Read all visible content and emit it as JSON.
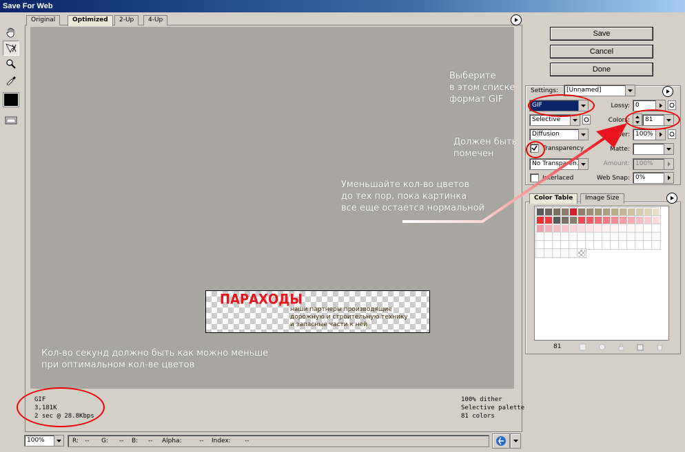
{
  "window": {
    "title": "Save For Web"
  },
  "tabs": [
    {
      "label": "Original"
    },
    {
      "label": "Optimized"
    },
    {
      "label": "2-Up"
    },
    {
      "label": "4-Up"
    }
  ],
  "preview": {
    "title": "ПАРАХОДЫ",
    "line1": "наши партнеры производящие",
    "line2": "дорожную и строительную технику",
    "line3": "и запасные части к ней"
  },
  "status_left": {
    "format": "GIF",
    "size": "3,181K",
    "time": "2 sec @ 28.8Kbps"
  },
  "status_right": {
    "dither": "100% dither",
    "palette": "Selective palette",
    "colors": "81 colors"
  },
  "annotations": {
    "choose_format": "Выберите\nв этом списке\nформат GIF",
    "must_check": "Должен быть\nпомечен",
    "reduce_colors": "Уменьшайте кол-во цветов\nдо тех пор, пока картинка\nвсе еще остается нормальной",
    "seconds": "Кол-во секунд должно быть как можно меньше\nпри оптимальном кол-ве цветов"
  },
  "buttons": {
    "save": "Save",
    "cancel": "Cancel",
    "done": "Done"
  },
  "settings": {
    "settings_label": "Settings:",
    "settings_value": "[Unnamed]",
    "format": "GIF",
    "reduction": "Selective",
    "dither_algo": "Diffusion",
    "transparency_label": "Transparency",
    "transparency_checked": true,
    "no_transparency": "No Transparen...",
    "interlaced_label": "Interlaced",
    "lossy_label": "Lossy:",
    "lossy_value": "0",
    "colors_label": "Colors:",
    "colors_value": "81",
    "dither_label": "Dither:",
    "dither_value": "100%",
    "matte_label": "Matte:",
    "amount_label": "Amount:",
    "amount_value": "100%",
    "websnap_label": "Web Snap:",
    "websnap_value": "0%"
  },
  "color_table": {
    "tab_label": "Color Table",
    "image_size_tab": "Image Size",
    "count": "81",
    "colors": [
      "#5c5a56",
      "#6e675d",
      "#7c705f",
      "#8a7c66",
      "#d8202c",
      "#8e8169",
      "#9a8d74",
      "#a29679",
      "#ad9f82",
      "#b8ab8c",
      "#c3b795",
      "#cdc1a0",
      "#d6cbaa",
      "#dfd5b6",
      "#e7dfc3",
      "#e8322f",
      "#ef3b3e",
      "#5e5b58",
      "#7a7164",
      "#897e6c",
      "#f14a50",
      "#f45a61",
      "#f66a72",
      "#f87a82",
      "#f98a93",
      "#fa9aa2",
      "#fbaab2",
      "#fcbac1",
      "#fdcad0",
      "#fed9de",
      "#f0a0a8",
      "#f4b0b8",
      "#f6bcc3",
      "#f8c7cd",
      "#fad2d7",
      "#fbdce0",
      "#fce4e7",
      "#fdebee",
      "#fef0f2",
      "#fef4f5",
      "#fff6f7",
      "#fff8f9",
      "#fffafa",
      "#fffbfb",
      "#fffcfc",
      "#ffffff",
      "#ffffff",
      "#ffffff",
      "#ffffff",
      "#ffffff",
      "#ffffff",
      "#ffffff",
      "#ffffff",
      "#ffffff",
      "#ffffff",
      "#ffffff",
      "#ffffff",
      "#ffffff",
      "#ffffff",
      "#ffffff",
      "#ffffff",
      "#ffffff",
      "#ffffff",
      "#ffffff",
      "#ffffff",
      "#ffffff",
      "#ffffff",
      "#ffffff",
      "#ffffff",
      "#ffffff",
      "#ffffff",
      "#ffffff",
      "#ffffff",
      "#ffffff",
      "#ffffff",
      "#ffffff",
      "#ffffff",
      "#ffffff",
      "#ffffff",
      "#ffffff",
      "transparent"
    ]
  },
  "bottom": {
    "zoom": "100%",
    "r_label": "R:",
    "r_val": "--",
    "g_label": "G:",
    "g_val": "--",
    "b_label": "B:",
    "b_val": "--",
    "alpha_label": "Alpha:",
    "alpha_val": "--",
    "index_label": "Index:",
    "index_val": "--"
  },
  "icons": [
    "hand-icon",
    "slice-select-icon",
    "zoom-icon",
    "eyedropper-icon",
    "toggle-slices-icon",
    "menu-arrow-icon",
    "browser-icon"
  ]
}
